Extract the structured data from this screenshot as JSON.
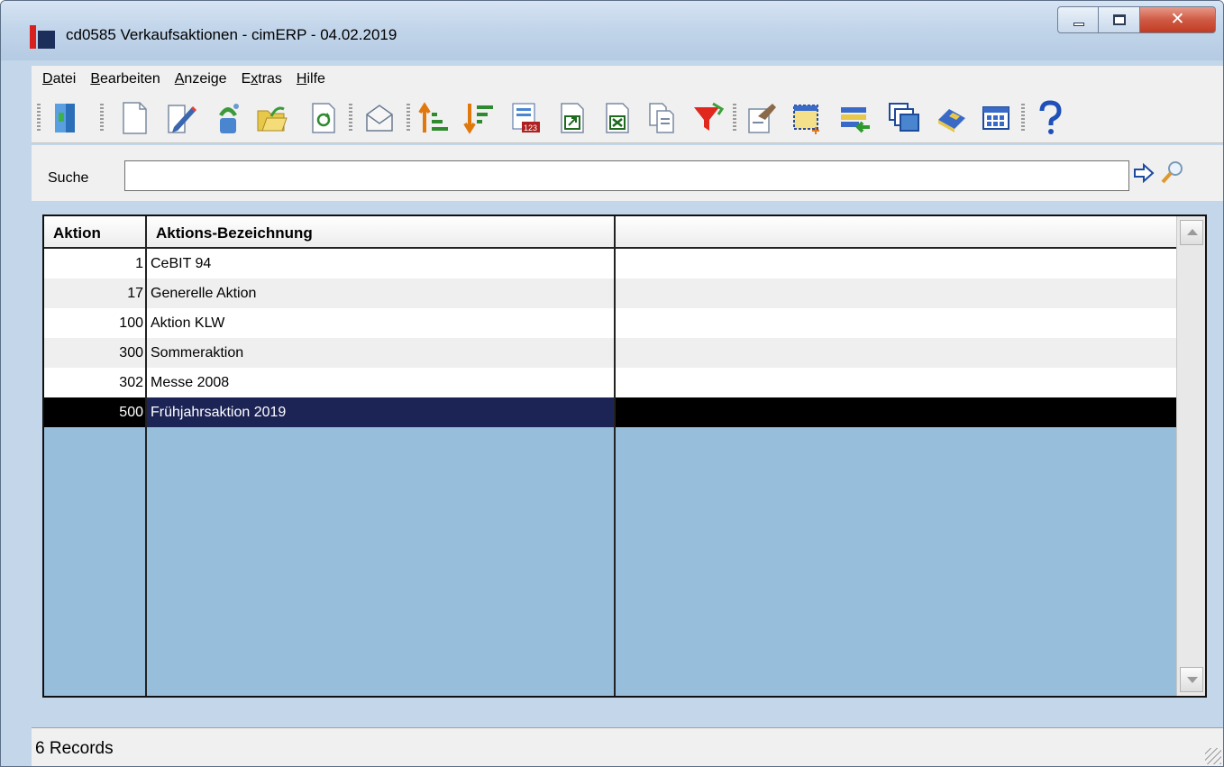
{
  "window": {
    "title": "cd0585 Verkaufsaktionen - cimERP - 04.02.2019"
  },
  "menu": [
    {
      "label": "Datei",
      "mnemonic": "D",
      "rest": "atei"
    },
    {
      "label": "Bearbeiten",
      "mnemonic": "B",
      "rest": "earbeiten"
    },
    {
      "label": "Anzeige",
      "mnemonic": "A",
      "rest": "nzeige"
    },
    {
      "label": "Extras",
      "pre": "E",
      "mnemonic": "x",
      "rest": "tras"
    },
    {
      "label": "Hilfe",
      "mnemonic": "H",
      "rest": "ilfe"
    }
  ],
  "toolbar": {
    "icons": [
      "exit-door-icon",
      "new-document-icon",
      "edit-pencil-icon",
      "recycle-icon",
      "open-folder-icon",
      "refresh-icon",
      "mail-icon",
      "sort-ascending-icon",
      "sort-descending-icon",
      "number-list-icon",
      "export-document-icon",
      "excel-export-icon",
      "copy-icon",
      "filter-funnel-icon",
      "clipboard-icon",
      "selection-icon",
      "import-icon",
      "windows-icon",
      "book-icon",
      "grid-icon",
      "help-icon"
    ]
  },
  "search": {
    "label": "Suche",
    "value": ""
  },
  "table": {
    "columns": [
      "Aktion",
      "Aktions-Bezeichnung",
      ""
    ],
    "rows": [
      {
        "id": "1",
        "name": "CeBIT 94"
      },
      {
        "id": "17",
        "name": "Generelle Aktion"
      },
      {
        "id": "100",
        "name": "Aktion KLW"
      },
      {
        "id": "300",
        "name": "Sommeraktion"
      },
      {
        "id": "302",
        "name": "Messe 2008"
      },
      {
        "id": "500",
        "name": "Frühjahrsaktion 2019"
      }
    ],
    "selected_row": 5
  },
  "status": {
    "text": "6 Records"
  },
  "colors": {
    "selection": "#1c2456",
    "grid_background": "#97bfdb",
    "window_frame": "#c3d6ea"
  }
}
